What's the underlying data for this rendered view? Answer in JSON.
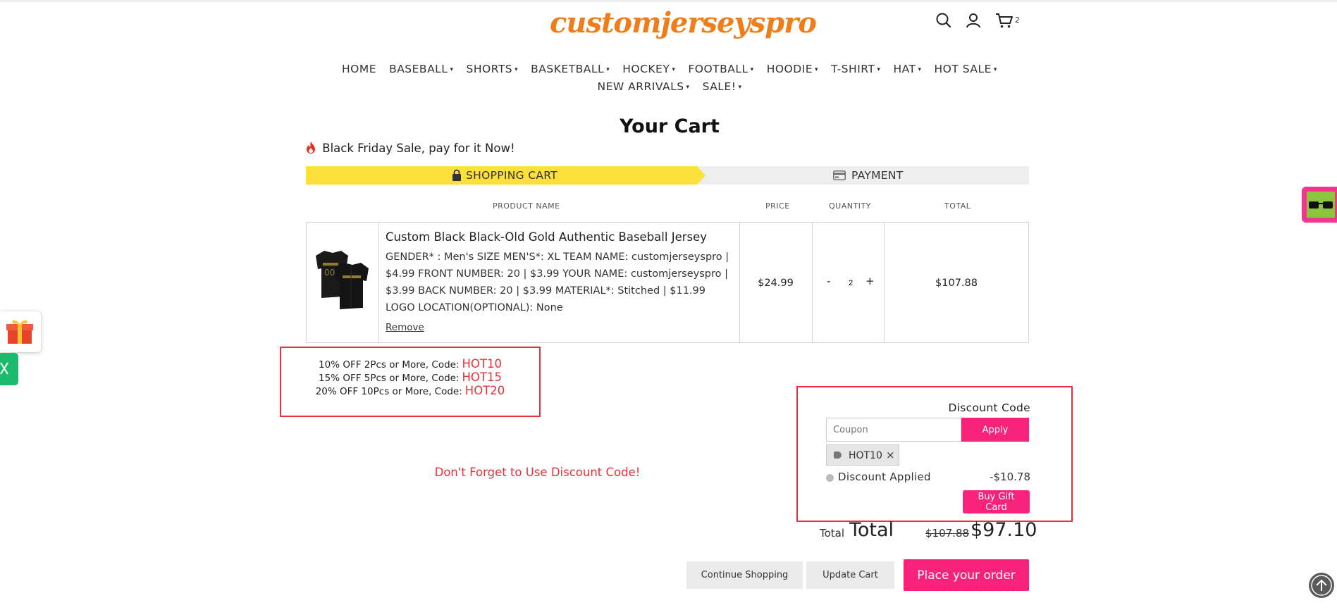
{
  "header": {
    "logo_text": "customjerseyspro",
    "cart_count": "2"
  },
  "nav": {
    "row1": [
      "HOME",
      "BASEBALL",
      "SHORTS",
      "BASKETBALL",
      "HOCKEY",
      "FOOTBALL",
      "HOODIE",
      "T-SHIRT",
      "HAT",
      "HOT SALE"
    ],
    "row2": [
      "NEW ARRIVALS",
      "SALE!"
    ],
    "dropdown_caret": "▾"
  },
  "page": {
    "title": "Your Cart",
    "promo_banner": "Black Friday Sale, pay for it Now!"
  },
  "steps": {
    "shopping_cart": "SHOPPING CART",
    "payment": "PAYMENT"
  },
  "table": {
    "headers": {
      "product_name": "PRODUCT NAME",
      "price": "PRICE",
      "quantity": "QUANTITY",
      "total": "TOTAL"
    },
    "item": {
      "name": "Custom Black Black-Old Gold Authentic Baseball Jersey",
      "options": "GENDER* : Men's    SIZE MEN'S*: XL    TEAM NAME: customjerseyspro | $4.99    FRONT NUMBER: 20 | $3.99    YOUR NAME: customjerseyspro | $3.99    BACK NUMBER: 20 | $3.99    MATERIAL*: Stitched | $11.99    LOGO LOCATION(OPTIONAL): None",
      "remove_label": "Remove",
      "price": "$24.99",
      "qty_minus": "-",
      "quantity": "2",
      "qty_plus": "+",
      "total": "$107.88"
    }
  },
  "codes": [
    {
      "text": "10% OFF 2Pcs or More, Code:",
      "code": "HOT10"
    },
    {
      "text": "15% OFF 5Pcs or More, Code:",
      "code": "HOT15"
    },
    {
      "text": "20% OFF 10Pcs or More, Code:",
      "code": "HOT20"
    }
  ],
  "reminder": "Don't Forget to Use Discount Code!",
  "discount": {
    "title": "Discount Code",
    "coupon_placeholder": "Coupon",
    "apply_label": "Apply",
    "applied_tag": "HOT10",
    "remove_tag": "×",
    "applied_label": "Discount Applied",
    "applied_amount": "-$10.78",
    "gift_card_label": "Buy Gift Card"
  },
  "totals": {
    "total_small": "Total",
    "total_big": "Total",
    "original": "$107.88",
    "final": "$97.10"
  },
  "buttons": {
    "continue_shopping": "Continue Shopping",
    "update_cart": "Update Cart",
    "place_order": "Place your order"
  },
  "colors": {
    "brand_orange": "#ef7d1a",
    "accent_pink": "#f7237a",
    "step_yellow": "#fde03a",
    "alert_red": "#e8313a"
  },
  "icons": [
    "search-icon",
    "account-icon",
    "cart-icon",
    "flame-icon",
    "lock-icon",
    "card-icon",
    "tag-icon",
    "gift-icon",
    "glasses-icon",
    "back-to-top-icon"
  ]
}
